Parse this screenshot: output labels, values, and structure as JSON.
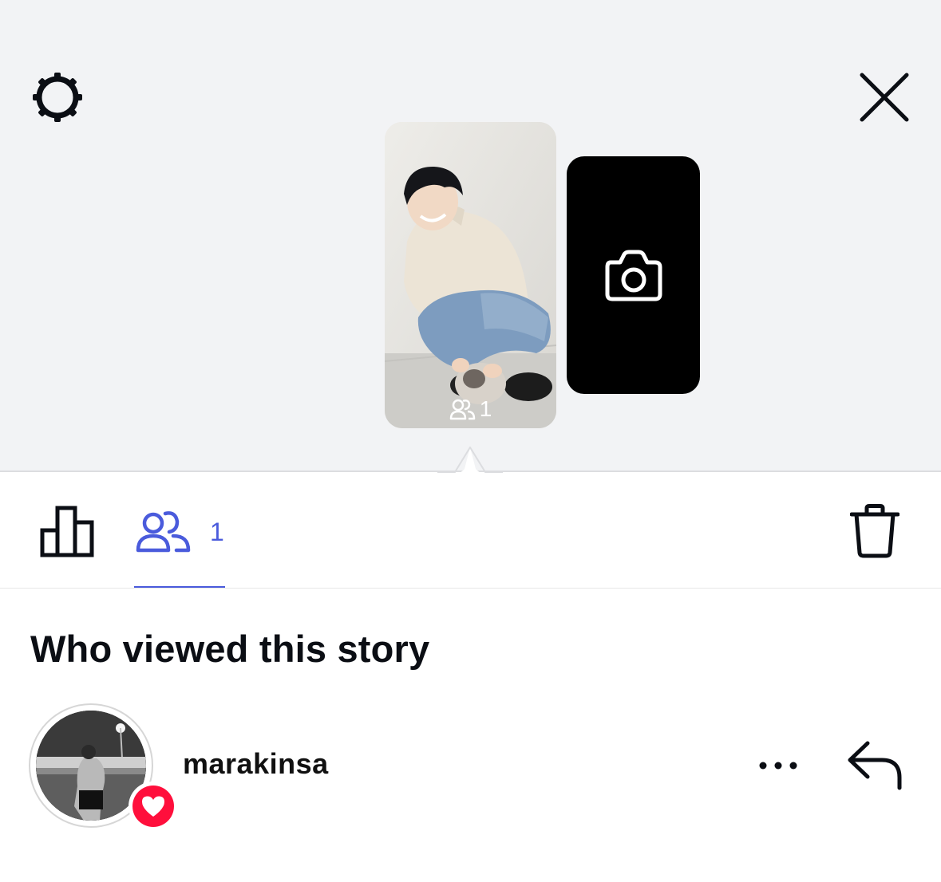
{
  "header": {
    "settings_icon": "gear-icon",
    "close_icon": "close-icon"
  },
  "stories": {
    "current": {
      "viewers_icon": "people-icon",
      "viewers_count": "1"
    },
    "add_story_icon": "camera-icon"
  },
  "tabs": {
    "insights_icon": "bar-chart-icon",
    "viewers_icon": "people-icon",
    "viewers_count": "1",
    "active_tab": "viewers",
    "delete_icon": "trash-icon"
  },
  "section": {
    "title": "Who viewed this story"
  },
  "viewers": [
    {
      "username": "marakinsa",
      "reaction": "heart",
      "more_icon": "more-horizontal-icon",
      "reply_icon": "reply-icon"
    }
  ],
  "colors": {
    "accent": "#4a5bdc",
    "reaction_heart": "#ff0f3c",
    "top_background": "#f2f3f5",
    "text": "#0b0e14"
  }
}
